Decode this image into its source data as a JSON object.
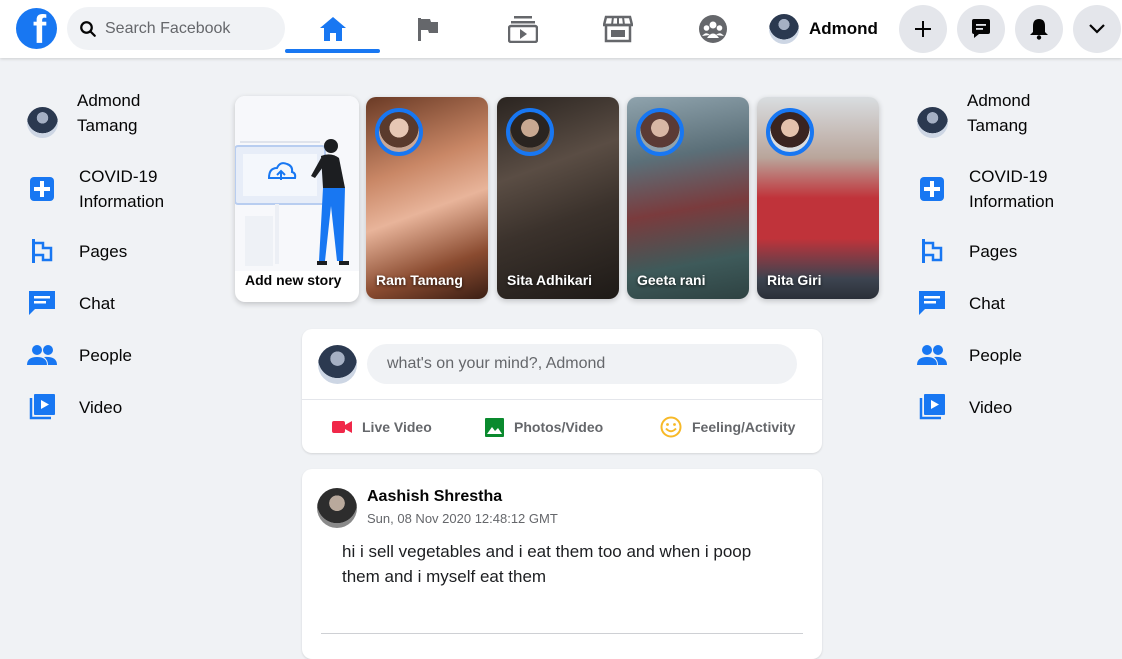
{
  "header": {
    "logo": "facebook-logo",
    "search_placeholder": "Search Facebook",
    "nav_tabs": [
      {
        "icon": "home-icon",
        "active": true
      },
      {
        "icon": "flag-icon",
        "active": false
      },
      {
        "icon": "watch-icon",
        "active": false
      },
      {
        "icon": "marketplace-icon",
        "active": false
      },
      {
        "icon": "groups-icon",
        "active": false
      }
    ],
    "profile_name": "Admond",
    "action_buttons": [
      "plus-icon",
      "messenger-icon",
      "bell-icon",
      "chevron-down-icon"
    ]
  },
  "sidebar_left": {
    "profile": "Admond Tamang",
    "items": [
      {
        "label": "COVID-19 Information",
        "icon": "covid-plus-icon"
      },
      {
        "label": "Pages",
        "icon": "pages-flag-icon"
      },
      {
        "label": "Chat",
        "icon": "chat-icon"
      },
      {
        "label": "People",
        "icon": "people-icon"
      },
      {
        "label": "Video",
        "icon": "video-icon"
      }
    ]
  },
  "sidebar_right": {
    "profile": "Admond Tamang",
    "items": [
      {
        "label": "COVID-19 Information",
        "icon": "covid-plus-icon"
      },
      {
        "label": "Pages",
        "icon": "pages-flag-icon"
      },
      {
        "label": "Chat",
        "icon": "chat-icon"
      },
      {
        "label": "People",
        "icon": "people-icon"
      },
      {
        "label": "Video",
        "icon": "video-icon"
      }
    ]
  },
  "stories": {
    "add_label": "Add new story",
    "items": [
      {
        "name": "Ram Tamang"
      },
      {
        "name": "Sita Adhikari"
      },
      {
        "name": "Geeta rani"
      },
      {
        "name": "Rita Giri"
      }
    ]
  },
  "composer": {
    "placeholder": "what's on your mind?, Admond",
    "actions": [
      {
        "label": "Live Video",
        "icon": "live-video-icon",
        "color": "#f02849"
      },
      {
        "label": "Photos/Video",
        "icon": "photo-icon",
        "color": "#45bd62"
      },
      {
        "label": "Feeling/Activity",
        "icon": "smiley-icon",
        "color": "#f7b928"
      }
    ]
  },
  "post": {
    "author": "Aashish Shrestha",
    "timestamp": "Sun, 08 Nov 2020 12:48:12 GMT",
    "text_line1": "hi i sell vegetables and i eat them too and when i poop",
    "text_line2": "them and i myself eat them"
  },
  "colors": {
    "brand": "#1877f2",
    "background": "#f0f2f5"
  }
}
